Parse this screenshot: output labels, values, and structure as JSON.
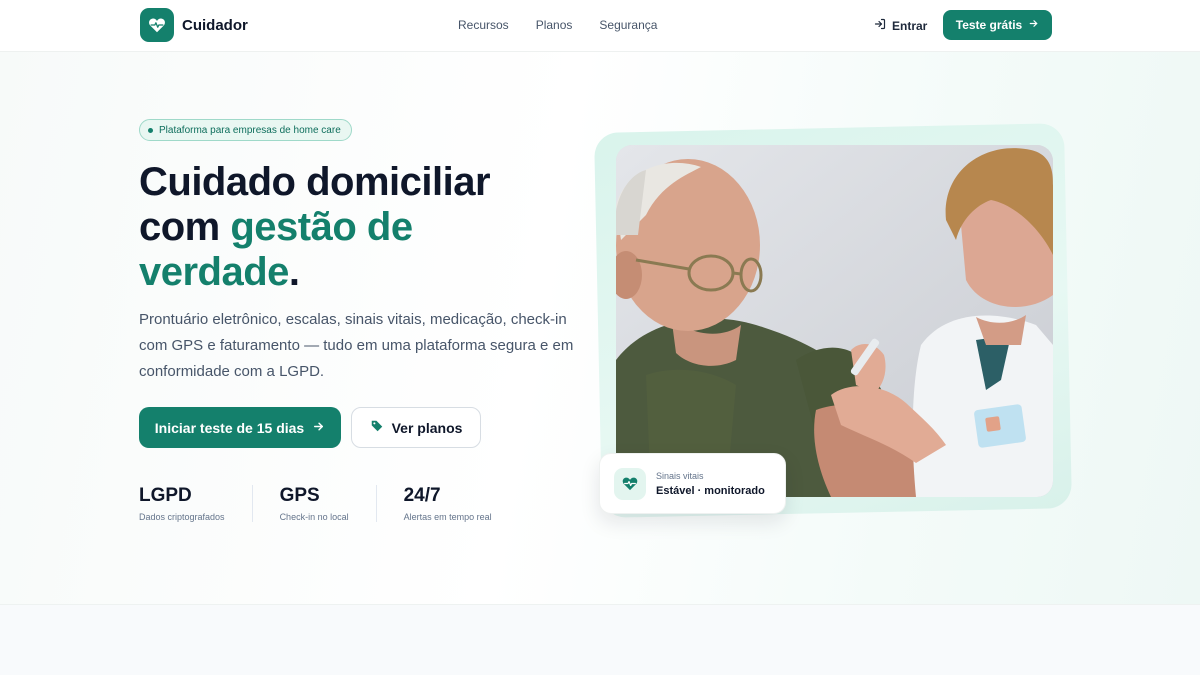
{
  "header": {
    "brand": "Cuidador",
    "nav": [
      "Recursos",
      "Planos",
      "Segurança"
    ],
    "login_label": "Entrar",
    "cta_label": "Teste grátis"
  },
  "hero": {
    "badge": "Plataforma para empresas de home care",
    "headline_part1": "Cuidado domiciliar com ",
    "headline_accent": "gestão de verdade",
    "headline_end": ".",
    "lede": "Prontuário eletrônico, escalas, sinais vitais, medicação, check-in com GPS e faturamento — tudo em uma plataforma segura e em conformidade com a LGPD.",
    "primary_button": "Iniciar teste de 15 dias",
    "secondary_button": "Ver planos",
    "stats": [
      {
        "value": "LGPD",
        "label": "Dados criptografados"
      },
      {
        "value": "GPS",
        "label": "Check-in no local"
      },
      {
        "value": "24/7",
        "label": "Alertas em tempo real"
      }
    ]
  },
  "vitals_card": {
    "label": "Sinais vitais",
    "status": "Estável · monitorado"
  },
  "icons": {
    "brand": "heart-pulse-icon",
    "login": "log-in-icon",
    "arrow": "arrow-right-icon",
    "tag": "tag-icon",
    "vitals": "heart-pulse-icon"
  },
  "colors": {
    "accent": "#14806c",
    "text": "#0f172a",
    "muted": "#475569"
  }
}
